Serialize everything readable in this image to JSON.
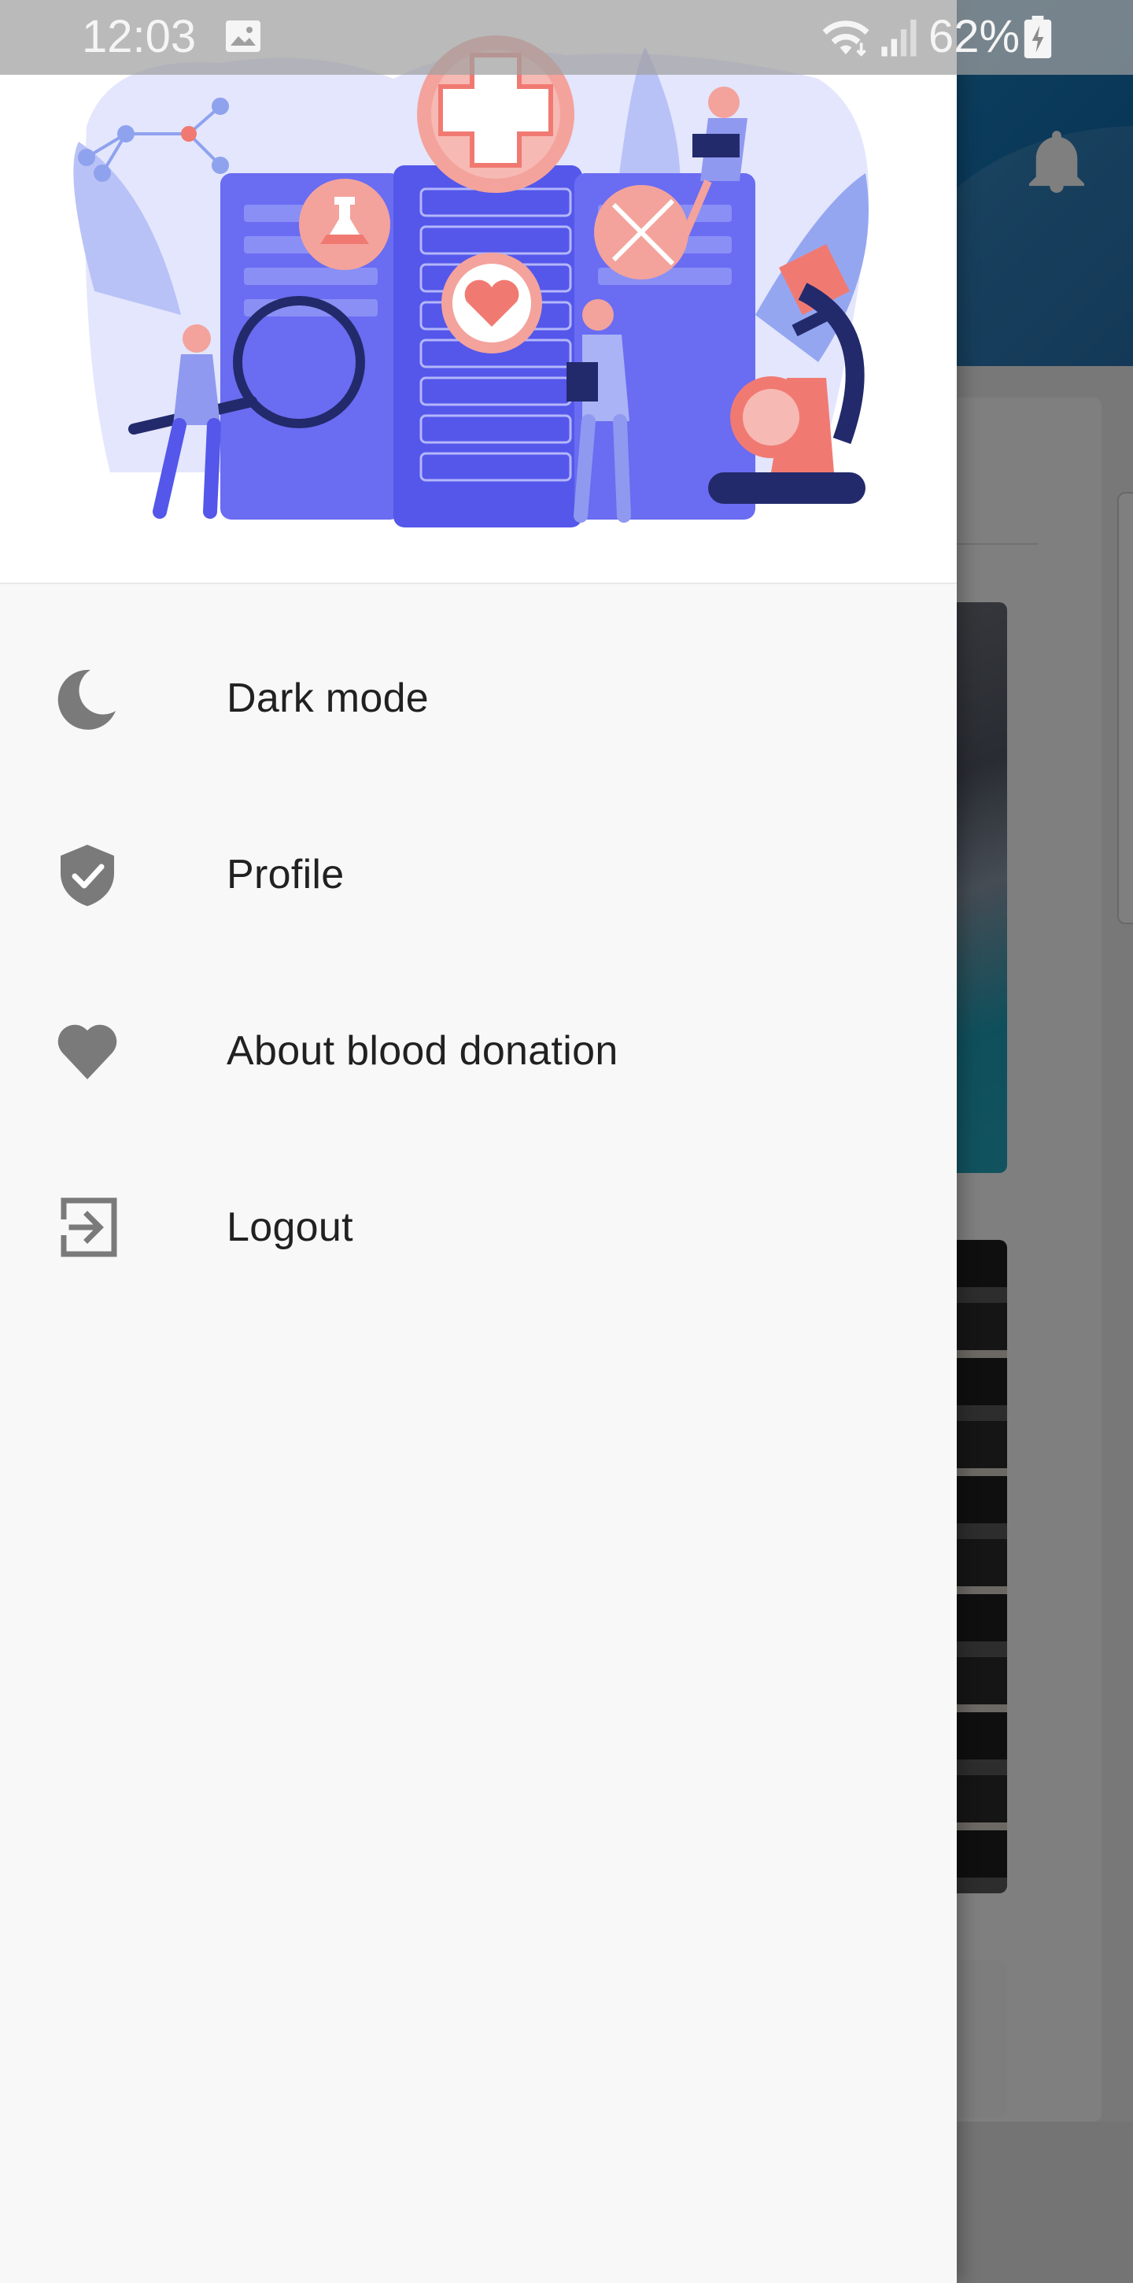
{
  "status_bar": {
    "time": "12:03",
    "battery_percent": "62%"
  },
  "drawer": {
    "menu": [
      {
        "label": "Dark mode",
        "icon": "moon-icon"
      },
      {
        "label": "Profile",
        "icon": "shield-check-icon"
      },
      {
        "label": "About blood donation",
        "icon": "heart-icon"
      },
      {
        "label": "Logout",
        "icon": "logout-icon"
      }
    ],
    "icon_color": "#7a7a7a"
  },
  "colors": {
    "header_blue": "#0b6db4",
    "illustration_blue": "#5b5ef0",
    "illustration_red": "#f07a72"
  }
}
